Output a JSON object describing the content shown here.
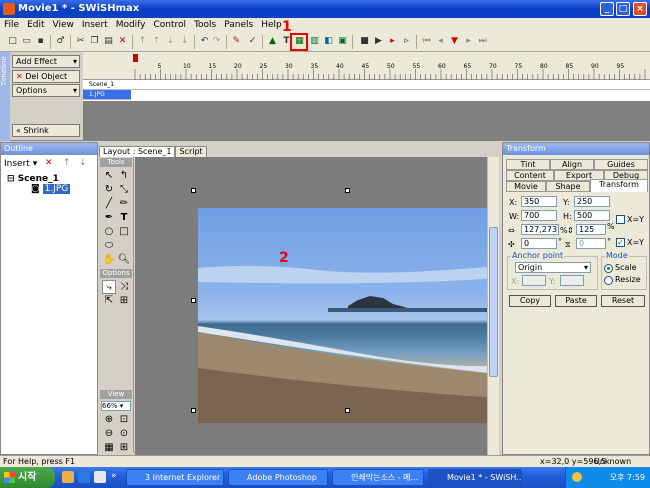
{
  "window": {
    "title": "Movie1 * - SWiSHmax"
  },
  "menu": [
    "File",
    "Edit",
    "View",
    "Insert",
    "Modify",
    "Control",
    "Tools",
    "Panels",
    "Help"
  ],
  "annotations": {
    "one": "1",
    "two": "2"
  },
  "timeline": {
    "side_label": "Timeline",
    "add_effect": "Add Effect",
    "del_object": "Del Object",
    "options": "Options",
    "shrink": "Shrink",
    "ruler_ticks": [
      "5",
      "10",
      "15",
      "20",
      "25",
      "30",
      "35",
      "40",
      "45",
      "50",
      "55",
      "60",
      "65",
      "70",
      "75",
      "80",
      "85",
      "90",
      "95",
      "100",
      "105"
    ],
    "tracks": [
      "Scene_1",
      "1.JPG"
    ]
  },
  "outline": {
    "title": "Outline",
    "insert": "Insert",
    "scene": "Scene_1",
    "item": "1.JPG"
  },
  "layout": {
    "tab_layout": "Layout : Scene_1",
    "tab_script": "Script",
    "tools_header": "Tools",
    "options_header": "Options",
    "view_header": "View",
    "zoom": "66%"
  },
  "transform": {
    "title": "Transform",
    "tabs_row1": [
      "Tint",
      "Align",
      "Guides"
    ],
    "tabs_row2": [
      "Content",
      "Export",
      "Debug"
    ],
    "tabs_row3": [
      "Movie",
      "Shape",
      "Transform"
    ],
    "x_label": "X:",
    "x": "350",
    "y_label": "Y:",
    "y": "250",
    "w_label": "W:",
    "w": "700",
    "h_label": "H:",
    "h": "500",
    "scale_x": "127,273",
    "scale_y": "125",
    "pct": "%",
    "rot": "0",
    "skew": "0",
    "deg": "°",
    "xeqy": "X=Y",
    "anchor_label": "Anchor point",
    "anchor": "Origin",
    "ax_label": "X:",
    "ay_label": "Y:",
    "mode_label": "Mode",
    "mode_scale": "Scale",
    "mode_resize": "Resize",
    "copy": "Copy",
    "paste": "Paste",
    "reset": "Reset"
  },
  "status": {
    "left": "For Help, press F1",
    "coords": "x=32,0 y=596,5",
    "size": "Unknown Size"
  },
  "taskbar": {
    "start": "시작",
    "tasks": [
      "3 Internet Explorer",
      "Adobe Photoshop",
      "인쇄막는소스 - 메...",
      "Movie1 * - SWiSH..."
    ],
    "clock": "오후 7:59"
  }
}
